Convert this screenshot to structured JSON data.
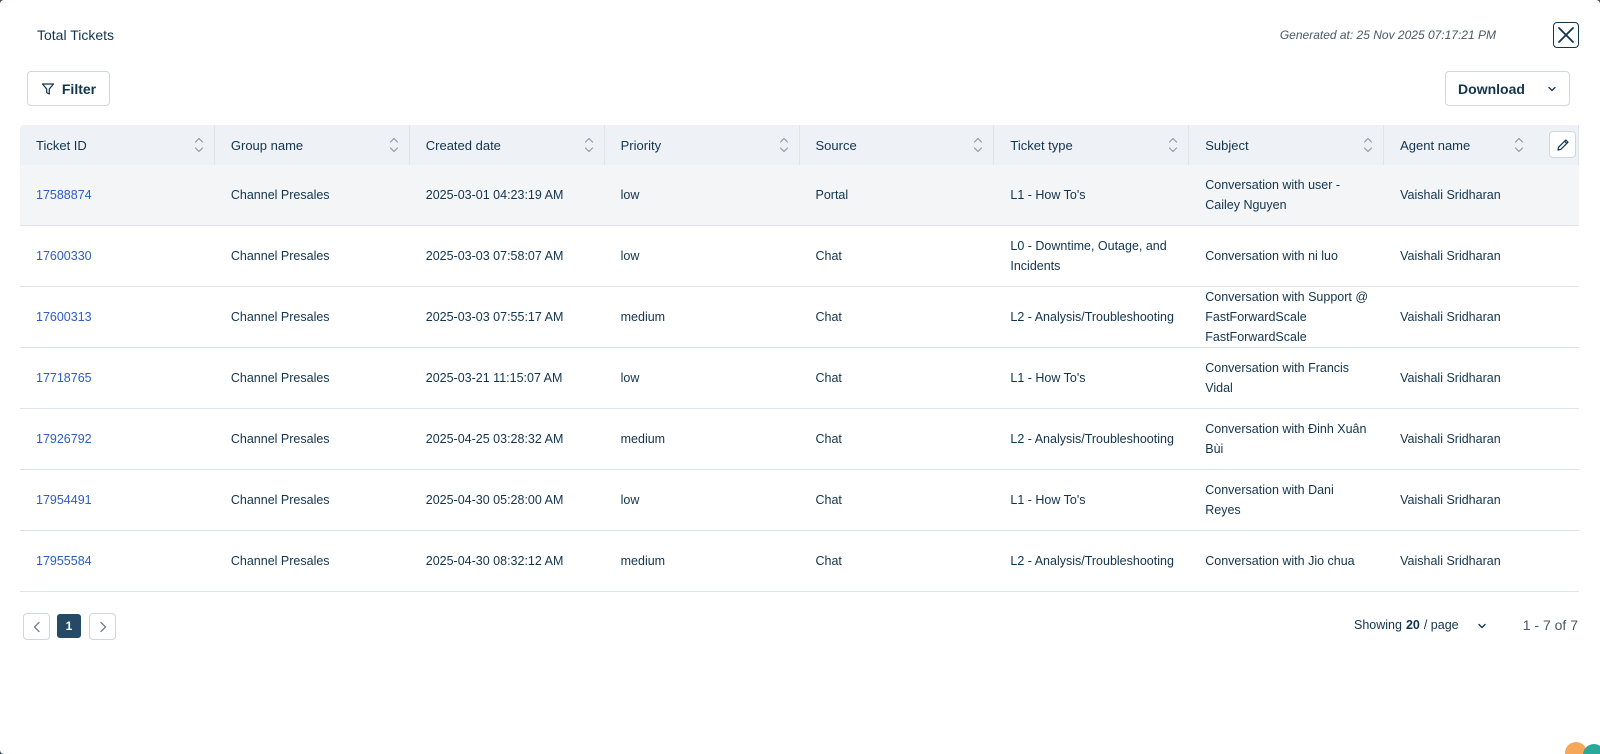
{
  "header": {
    "title": "Total Tickets",
    "generated": "Generated at: 25 Nov 2025 07:17:21 PM"
  },
  "toolbar": {
    "filter_label": "Filter",
    "download_label": "Download"
  },
  "table": {
    "columns": [
      "Ticket ID",
      "Group name",
      "Created date",
      "Priority",
      "Source",
      "Ticket type",
      "Subject",
      "Agent name"
    ],
    "rows": [
      [
        "17588874",
        "Channel Presales",
        "2025-03-01 04:23:19 AM",
        "low",
        "Portal",
        "L1 - How To's",
        "Conversation with user - Cailey Nguyen",
        "Vaishali Sridharan"
      ],
      [
        "17600330",
        "Channel Presales",
        "2025-03-03 07:58:07 AM",
        "low",
        "Chat",
        "L0 - Downtime, Outage, and Incidents",
        "Conversation with ni luo",
        "Vaishali Sridharan"
      ],
      [
        "17600313",
        "Channel Presales",
        "2025-03-03 07:55:17 AM",
        "medium",
        "Chat",
        "L2 - Analysis/Troubleshooting",
        "Conversation with Support @ FastForwardScale FastForwardScale",
        "Vaishali Sridharan"
      ],
      [
        "17718765",
        "Channel Presales",
        "2025-03-21 11:15:07 AM",
        "low",
        "Chat",
        "L1 - How To's",
        "Conversation with Francis Vidal",
        "Vaishali Sridharan"
      ],
      [
        "17926792",
        "Channel Presales",
        "2025-04-25 03:28:32 AM",
        "medium",
        "Chat",
        "L2 - Analysis/Troubleshooting",
        "Conversation with Đinh Xuân Bùi",
        "Vaishali Sridharan"
      ],
      [
        "17954491",
        "Channel Presales",
        "2025-04-30 05:28:00 AM",
        "low",
        "Chat",
        "L1 - How To's",
        "Conversation with Dani Reyes",
        "Vaishali Sridharan"
      ],
      [
        "17955584",
        "Channel Presales",
        "2025-04-30 08:32:12 AM",
        "medium",
        "Chat",
        "L2 - Analysis/Troubleshooting",
        "Conversation with Jio chua",
        "Vaishali Sridharan"
      ]
    ]
  },
  "pagination": {
    "current_page": "1",
    "showing_prefix": "Showing",
    "page_size": "20",
    "showing_suffix": "/ page",
    "range": "1 - 7 of 7"
  },
  "colors": {
    "link": "#2c5cc5",
    "active_page": "#264966",
    "header_bg": "#eef1f5"
  }
}
